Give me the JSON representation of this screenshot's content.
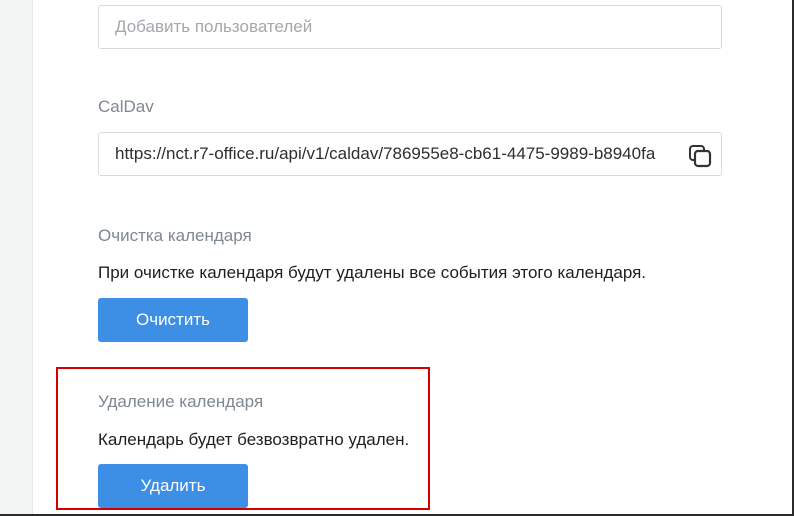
{
  "users": {
    "placeholder": "Добавить пользователей"
  },
  "caldav": {
    "label": "CalDav",
    "url": "https://nct.r7-office.ru/api/v1/caldav/786955e8-cb61-4475-9989-b8940fa",
    "copy_icon": "copy-icon"
  },
  "clear": {
    "label": "Очистка календаря",
    "description": "При очистке календаря будут удалены все события этого календаря.",
    "button": "Очистить"
  },
  "delete": {
    "label": "Удаление календаря",
    "description": "Календарь будет безвозвратно удален.",
    "button": "Удалить"
  },
  "colors": {
    "accent": "#3d8ee5",
    "highlight": "#d40000"
  }
}
